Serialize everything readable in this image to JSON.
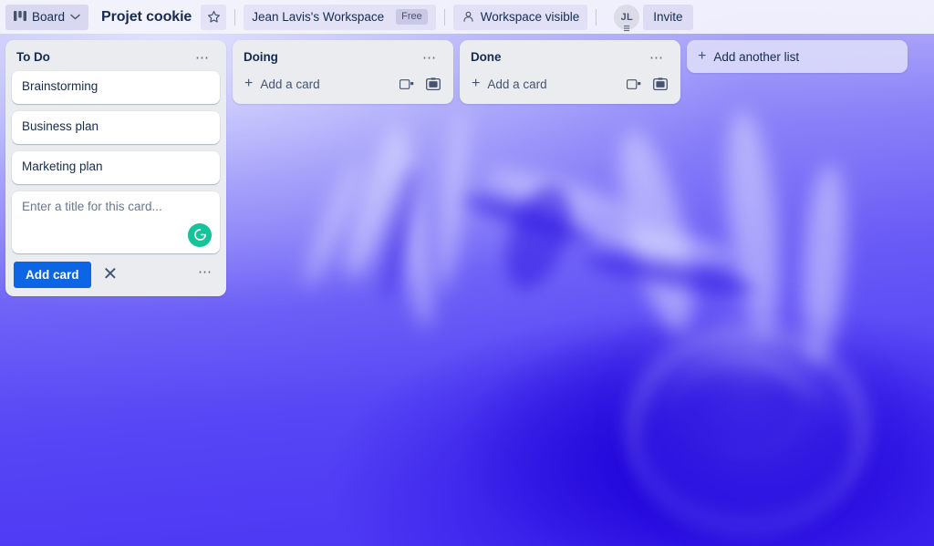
{
  "header": {
    "board_button": {
      "label": "Board",
      "icon": "board-grid-icon",
      "chevron": "chevron-down-icon"
    },
    "board_title": "Projet cookie",
    "star": {
      "icon": "star-icon"
    },
    "workspace": {
      "name": "Jean Lavis's Workspace",
      "plan_badge": "Free"
    },
    "visibility": {
      "label": "Workspace visible",
      "icon": "people-icon"
    },
    "avatar": {
      "initials": "JL"
    },
    "invite_label": "Invite"
  },
  "board": {
    "background_color": "#5b4ef5",
    "accent_color": "#0c66e4",
    "list_bg_color": "#ebecf0",
    "grammarly_color": "#15c39a",
    "add_list_label": "Add another list",
    "lists": [
      {
        "title": "To Do",
        "menu_icon": "ellipsis-icon",
        "cards": [
          {
            "title": "Brainstorming"
          },
          {
            "title": "Business plan"
          },
          {
            "title": "Marketing plan"
          }
        ],
        "composer": {
          "open": true,
          "placeholder": "Enter a title for this card...",
          "value": "",
          "submit_label": "Add card",
          "close_icon": "close-x-icon",
          "more_icon": "ellipsis-icon",
          "grammarly_icon": "grammarly-icon"
        }
      },
      {
        "title": "Doing",
        "menu_icon": "ellipsis-icon",
        "cards": [],
        "add_card": {
          "label": "Add a card",
          "plus_icon": "plus-icon",
          "template_icon": "card-template-icon",
          "image_icon": "image-attachment-icon"
        }
      },
      {
        "title": "Done",
        "menu_icon": "ellipsis-icon",
        "cards": [],
        "add_card": {
          "label": "Add a card",
          "plus_icon": "plus-icon",
          "template_icon": "card-template-icon",
          "image_icon": "image-attachment-icon"
        }
      }
    ]
  }
}
